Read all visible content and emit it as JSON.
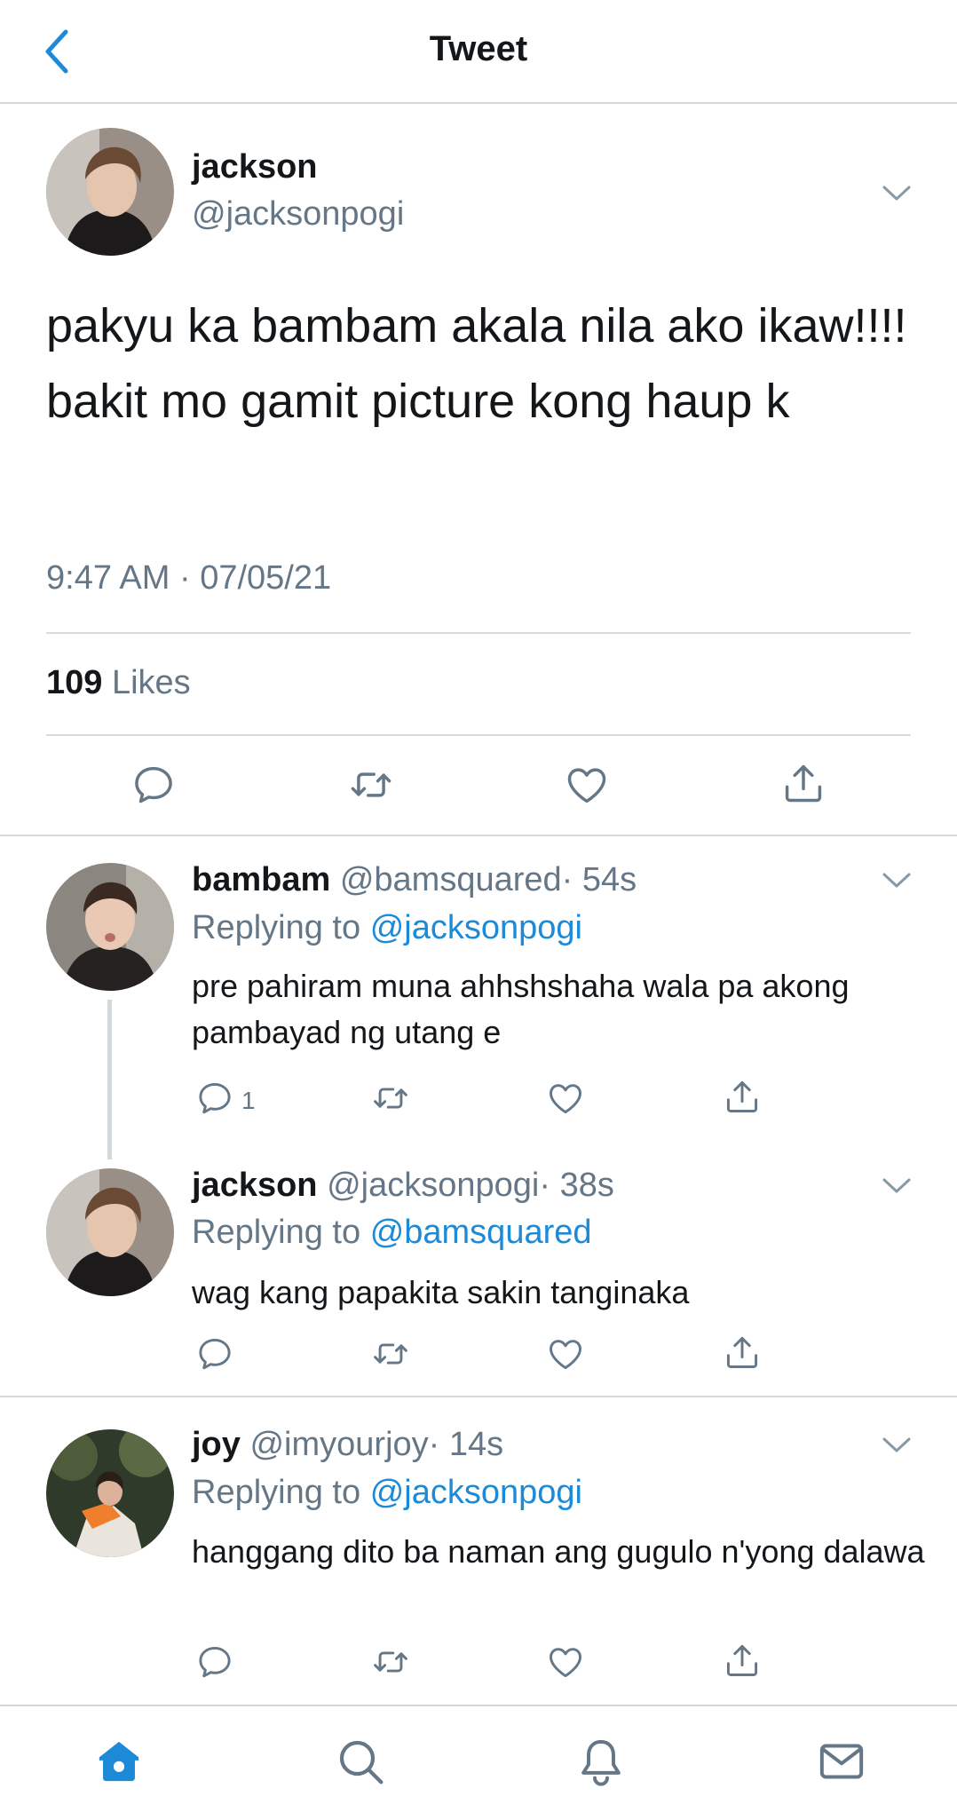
{
  "header": {
    "title": "Tweet"
  },
  "tweet": {
    "name": "jackson",
    "handle": "@jacksonpogi",
    "text": "pakyu ka bambam akala nila ako ikaw!!!! bakit mo gamit picture kong haup k",
    "timestamp": "9:47 AM · 07/05/21",
    "likes_count": "109",
    "likes_label": "Likes"
  },
  "replies": [
    {
      "name": "bambam",
      "handle": "@bamsquared",
      "time": "· 54s",
      "replying_prefix": "Replying to",
      "replying_to": "@jacksonpogi",
      "text": "pre pahiram muna ahhshshaha wala pa akong pambayad ng utang e",
      "reply_count": "1"
    },
    {
      "name": "jackson",
      "handle": "@jacksonpogi",
      "time": "· 38s",
      "replying_prefix": "Replying to",
      "replying_to": "@bamsquared",
      "text": "wag kang papakita sakin tanginaka",
      "reply_count": ""
    },
    {
      "name": "joy",
      "handle": "@imyourjoy",
      "time": "· 14s",
      "replying_prefix": "Replying to",
      "replying_to": "@jacksonpogi",
      "text": "hanggang dito ba naman ang gugulo n'yong dalawa",
      "reply_count": ""
    }
  ],
  "icons": {
    "back": "chevron-left-icon",
    "more": "chevron-down-icon",
    "reply": "comment-icon",
    "retweet": "retweet-icon",
    "like": "heart-icon",
    "share": "share-icon",
    "tab_home": "home-icon",
    "tab_search": "search-icon",
    "tab_notifications": "bell-icon",
    "tab_messages": "mail-icon"
  },
  "colors": {
    "accent": "#1d8ad8",
    "secondary_text": "#657786",
    "primary_text": "#14171a"
  }
}
